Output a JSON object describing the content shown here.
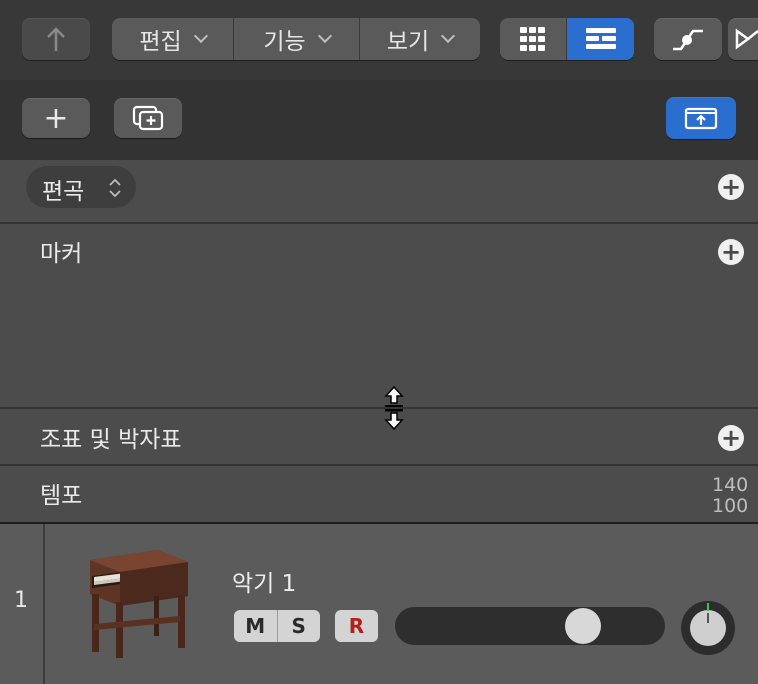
{
  "toolbar": {
    "back_label": "↑",
    "menus": [
      {
        "label": "편집"
      },
      {
        "label": "기능"
      },
      {
        "label": "보기"
      }
    ],
    "view_buttons": [
      "grid-view",
      "list-view"
    ],
    "accent": "#2a6ecf"
  },
  "toolbar2": {
    "add_label": "+"
  },
  "global_tracks": {
    "arrangement": {
      "label": "편곡"
    },
    "marker": {
      "label": "마커"
    },
    "signature": {
      "label": "조표 및 박자표"
    },
    "tempo": {
      "label": "템포",
      "tick_high": "140",
      "tick_low": "100"
    }
  },
  "track": {
    "number": "1",
    "name": "악기 1",
    "mute_label": "M",
    "solo_label": "S",
    "record_label": "R",
    "volume_level": 0.73
  }
}
